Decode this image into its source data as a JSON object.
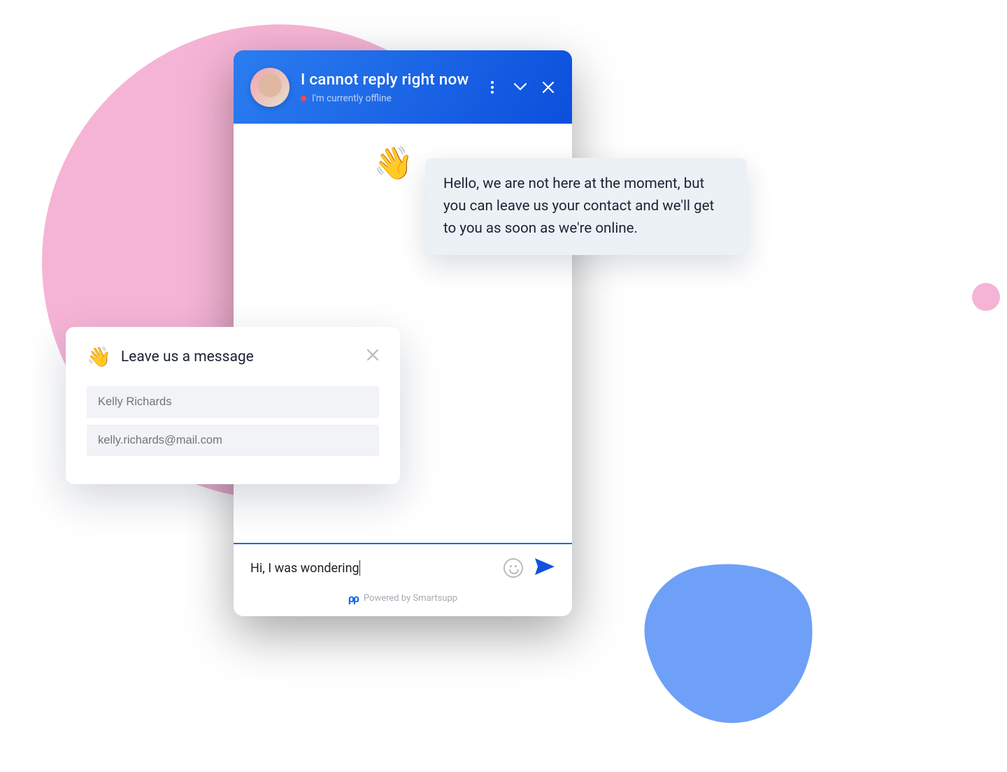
{
  "chat": {
    "header": {
      "title": "I cannot reply right now",
      "status_text": "I'm currently offline"
    },
    "wave_emoji": "👋",
    "input": {
      "value": "Hi, I was wondering"
    },
    "footer": {
      "logo": "ρρ",
      "text": "Powered by Smartsupp"
    }
  },
  "tooltip": {
    "text": "Hello, we are not here at the moment, but you can leave us your contact and we'll get to you as soon as we're online."
  },
  "leave_message": {
    "wave_emoji": "👋",
    "title": "Leave us a message",
    "name_placeholder": "Kelly Richards",
    "email_placeholder": "kelly.richards@mail.com"
  }
}
